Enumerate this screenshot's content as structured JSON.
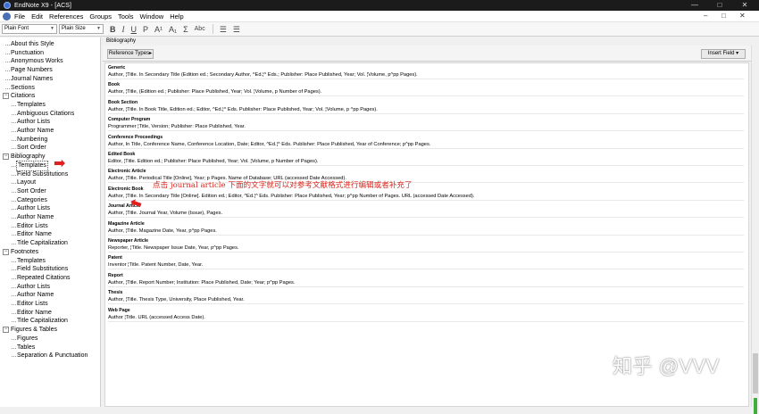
{
  "window": {
    "title": "EndNote X9 - [ACS]",
    "controls": [
      "—",
      "□",
      "✕"
    ]
  },
  "menubar": {
    "items": [
      "File",
      "Edit",
      "References",
      "Groups",
      "Tools",
      "Window",
      "Help"
    ],
    "mdi_controls": [
      "–",
      "□",
      "✕"
    ]
  },
  "toolbar": {
    "font": "Plain Font",
    "size": "Plain Size",
    "buttons": [
      "B",
      "I",
      "U",
      "P",
      "A¹",
      "A₁",
      "Σ",
      "Abc"
    ]
  },
  "sidebar": {
    "sections": [
      {
        "label": "About this Style",
        "level": 0
      },
      {
        "label": "Punctuation",
        "level": 0
      },
      {
        "label": "Anonymous Works",
        "level": 0
      },
      {
        "label": "Page Numbers",
        "level": 0
      },
      {
        "label": "Journal Names",
        "level": 0
      },
      {
        "label": "Sections",
        "level": 0
      },
      {
        "label": "Citations",
        "level": 0,
        "expanded": true
      },
      {
        "label": "Templates",
        "level": 1
      },
      {
        "label": "Ambiguous Citations",
        "level": 1
      },
      {
        "label": "Author Lists",
        "level": 1
      },
      {
        "label": "Author Name",
        "level": 1
      },
      {
        "label": "Numbering",
        "level": 1
      },
      {
        "label": "Sort Order",
        "level": 1
      },
      {
        "label": "Bibliography",
        "level": 0,
        "expanded": true
      },
      {
        "label": "Templates",
        "level": 1,
        "selected": true
      },
      {
        "label": "Field Substitutions",
        "level": 1
      },
      {
        "label": "Layout",
        "level": 1
      },
      {
        "label": "Sort Order",
        "level": 1
      },
      {
        "label": "Categories",
        "level": 1
      },
      {
        "label": "Author Lists",
        "level": 1
      },
      {
        "label": "Author Name",
        "level": 1
      },
      {
        "label": "Editor Lists",
        "level": 1
      },
      {
        "label": "Editor Name",
        "level": 1
      },
      {
        "label": "Title Capitalization",
        "level": 1
      },
      {
        "label": "Footnotes",
        "level": 0,
        "expanded": true
      },
      {
        "label": "Templates",
        "level": 1
      },
      {
        "label": "Field Substitutions",
        "level": 1
      },
      {
        "label": "Repeated Citations",
        "level": 1
      },
      {
        "label": "Author Lists",
        "level": 1
      },
      {
        "label": "Author Name",
        "level": 1
      },
      {
        "label": "Editor Lists",
        "level": 1
      },
      {
        "label": "Editor Name",
        "level": 1
      },
      {
        "label": "Title Capitalization",
        "level": 1
      },
      {
        "label": "Figures & Tables",
        "level": 0,
        "expanded": true
      },
      {
        "label": "Figures",
        "level": 1
      },
      {
        "label": "Tables",
        "level": 1
      },
      {
        "label": "Separation & Punctuation",
        "level": 1
      }
    ]
  },
  "main": {
    "header": "Bibliography",
    "reference_types_button": "Reference Types▸",
    "insert_field_button": "Insert Field ▾",
    "templates": [
      {
        "type": "Generic",
        "text": "Author, ¦Title. In Secondary Title (Edition ed.; Secondary Author, ^Ed.¦^ Eds.; Publisher: Place Published, Year; Vol. ¦Volume, p^pp Pages)."
      },
      {
        "type": "Book",
        "text": "Author, ¦Title, (Edition ed.; Publisher: Place Published, Year; Vol. ¦Volume, p Number of Pages)."
      },
      {
        "type": "Book Section",
        "text": "Author, ¦Title. In Book Title, Edition ed.; Editor, ^Ed.¦^ Eds. Publisher: Place Published, Year; Vol. ¦Volume, p ^pp Pages)."
      },
      {
        "type": "Computer Program",
        "text": "Programmer ¦Title, Version; Publisher: Place Published, Year."
      },
      {
        "type": "Conference Proceedings",
        "text": "Author, In Title, Conference Name, Conference Location, Date; Editor, ^Ed.¦^ Eds. Publisher: Place Published, Year of Conference; p^pp Pages."
      },
      {
        "type": "Edited Book",
        "text": "Editor, ¦Title. Edition ed.; Publisher: Place Published, Year; Vol. ¦Volume, p Number of Pages)."
      },
      {
        "type": "Electronic Article",
        "text": "Author, ¦Title. Periodical Title [Online], Year; p Pages. Name of Database; URL (accessed Date Accessed)."
      },
      {
        "type": "Electronic Book",
        "text": "Author, ¦Title. In Secondary Title [Online]. Edition ed.; Editor, ^Ed.¦^ Eds. Publisher: Place Published, Year; p^pp Number of Pages. URL (accessed Date Accessed)."
      },
      {
        "type": "Journal Article",
        "text": "Author, ¦Title. Journal Year, Volume (Issue), Pages."
      },
      {
        "type": "Magazine Article",
        "text": "Author, ¦Title. Magazine Date, Year, p^pp Pages."
      },
      {
        "type": "Newspaper Article",
        "text": "Reporter, ¦Title. Newspaper Issue Date, Year, p^pp Pages."
      },
      {
        "type": "Patent",
        "text": "Inventor ¦Title. Patent Number, Date, Year."
      },
      {
        "type": "Report",
        "text": "Author, ¦Title. Report Number; Institution: Place Published, Date; Year; p^pp Pages."
      },
      {
        "type": "Thesis",
        "text": "Author, ¦Title. Thesis Type, University, Place Published, Year."
      },
      {
        "type": "Web Page",
        "text": "Author ¦Title. URL (accessed Access Date)."
      }
    ],
    "annotation": "点击 journal article 下面的文字就可以对参考文献格式进行编辑或者补充了",
    "watermark": "知乎 @VVV"
  },
  "colors": {
    "annotation": "#d9261c",
    "titlebar": "#1b1b1b"
  }
}
